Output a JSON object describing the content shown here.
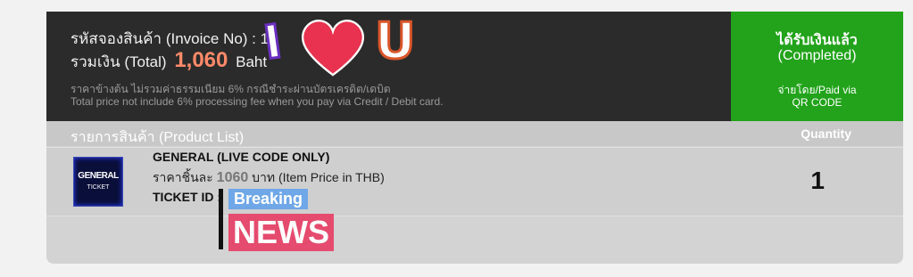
{
  "invoice": {
    "label": "รหัสจองสินค้า (Invoice No) : ",
    "number": "13"
  },
  "total": {
    "label": "รวมเงิน (Total)",
    "amount": "1,060",
    "currency": "Baht"
  },
  "notes": {
    "thai": "ราคาข้างต้น ไม่รวมค่าธรรมเนียม 6% กรณีชำระผ่านบัตรเครดิต/เดบิต",
    "english": "Total price not include 6% processing fee when you pay via Credit / Debit card."
  },
  "status": {
    "thai": "ได้รับเงินแล้ว",
    "english": "(Completed)",
    "paid_via": "จ่ายโดย/Paid via",
    "method": "QR CODE",
    "color": "#22a31b"
  },
  "product_list": {
    "title": "รายการสินค้า (Product List)",
    "quantity_header": "Quantity",
    "items": [
      {
        "thumb_title": "GENERAL",
        "thumb_sub": "TICKET",
        "name": "GENERAL (LIVE CODE ONLY)",
        "price_prefix": "ราคาชิ้นละ",
        "price": "1060",
        "price_suffix": "บาท (Item Price in THB)",
        "ticket_id_label": "TICKET ID :",
        "quantity": "1"
      }
    ]
  },
  "overlays": {
    "letter_i": "I",
    "letter_u": "U",
    "breaking": "Breaking",
    "news": "NEWS"
  },
  "colors": {
    "header_bg": "#2b2b2b",
    "total_amount": "#ff8a6a",
    "heart": "#e8324f"
  }
}
